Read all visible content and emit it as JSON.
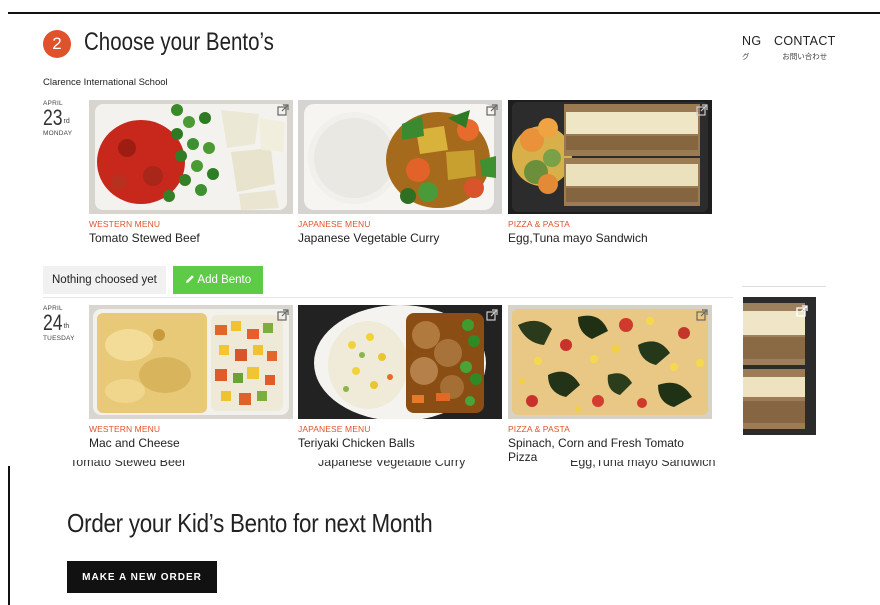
{
  "nav": [
    {
      "label": "NG",
      "sub": "グ"
    },
    {
      "label": "CONTACT",
      "sub": "お問い合わせ"
    }
  ],
  "step_number": "2",
  "title": "Choose your Bento’s",
  "school": "Clarence International School",
  "days": [
    {
      "month": "APRIL",
      "day": "23",
      "suffix": "rd",
      "weekday": "MONDAY",
      "items": [
        {
          "category": "WESTERN MENU",
          "name": "Tomato Stewed Beef",
          "image": "tomato-stewed-beef"
        },
        {
          "category": "JAPANESE MENU",
          "name": "Japanese Vegetable Curry",
          "image": "vegetable-curry"
        },
        {
          "category": "PIZZA & PASTA",
          "name": "Egg,Tuna mayo Sandwich",
          "image": "egg-tuna-sandwich"
        }
      ]
    },
    {
      "month": "APRIL",
      "day": "24",
      "suffix": "th",
      "weekday": "TUESDAY",
      "items": [
        {
          "category": "WESTERN MENU",
          "name": "Mac and Cheese",
          "image": "mac-and-cheese"
        },
        {
          "category": "JAPANESE MENU",
          "name": "Teriyaki Chicken Balls",
          "image": "teriyaki-chicken-balls"
        },
        {
          "category": "PIZZA & PASTA",
          "name": "Spinach, Corn and Fresh Tomato Pizza",
          "image": "spinach-corn-pizza"
        }
      ]
    }
  ],
  "selection_status": "Nothing choosed yet",
  "add_bento_label": "Add Bento",
  "add_bento_icon": "pencil-icon",
  "external_link_icon": "external-link-icon",
  "background": {
    "behind_names": [
      "Tomato Stewed Beef",
      "Japanese Vegetable Curry",
      "Egg,Tuna mayo Sandwich"
    ],
    "headline": "Order your Kid’s Bento for next Month",
    "order_button": "MAKE A NEW ORDER"
  },
  "colors": {
    "accent": "#e0522c",
    "add_button": "#5ecb46",
    "order_button": "#111111"
  }
}
